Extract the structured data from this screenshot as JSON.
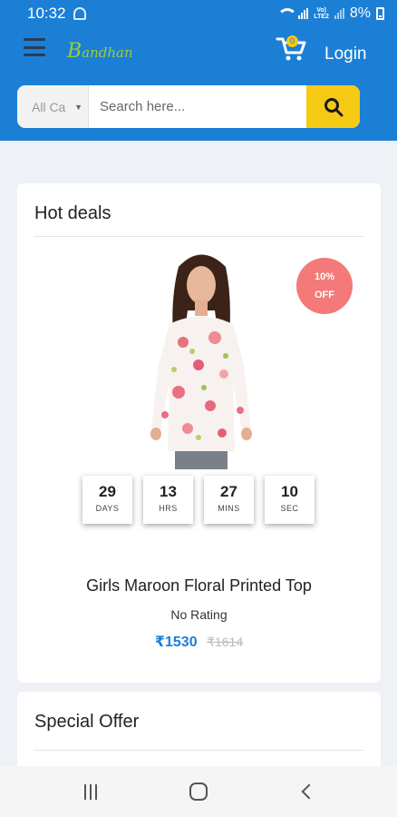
{
  "status_bar": {
    "time": "10:32",
    "network_label": "Vo)\nLTE2",
    "battery": "8%"
  },
  "header": {
    "logo_text": "Bandhan",
    "cart_count": "0",
    "login_label": "Login",
    "brand_color": "#1b7fd6",
    "accent_color": "#f6c915"
  },
  "search": {
    "category_value": "All Ca",
    "placeholder": "Search here...",
    "search_icon": "search-icon"
  },
  "hot_deals": {
    "title": "Hot deals",
    "discount_line1": "10%",
    "discount_line2": "OFF",
    "countdown": [
      {
        "value": "29",
        "label": "DAYS"
      },
      {
        "value": "13",
        "label": "HRS"
      },
      {
        "value": "27",
        "label": "MINS"
      },
      {
        "value": "10",
        "label": "SEC"
      }
    ],
    "product_name": "Girls Maroon Floral Printed Top",
    "rating": "No Rating",
    "price": "₹1530",
    "old_price": "₹1614"
  },
  "special_offer": {
    "title": "Special Offer"
  },
  "nav": {
    "recents_icon": "recents-icon",
    "home_icon": "home-icon",
    "back_icon": "back-icon"
  }
}
